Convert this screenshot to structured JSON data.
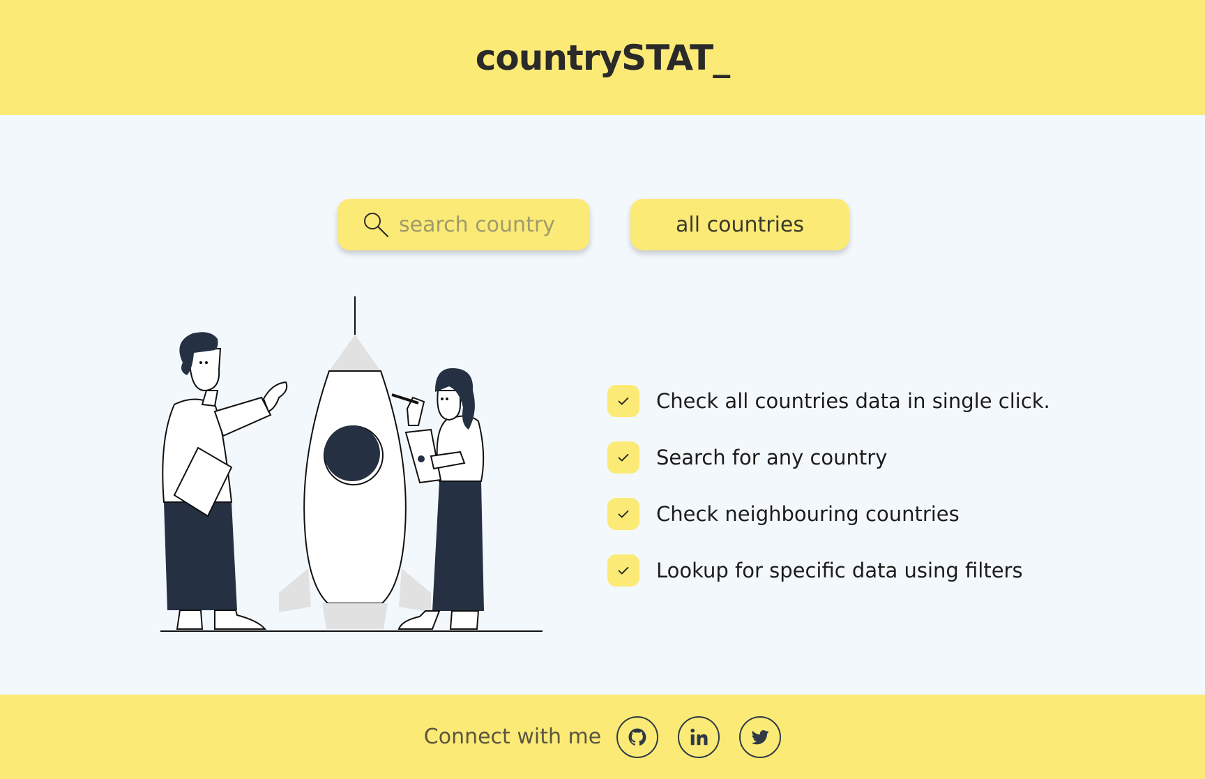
{
  "header": {
    "brand": "countrySTAT_"
  },
  "search": {
    "placeholder": "search country",
    "value": ""
  },
  "buttons": {
    "all_countries": "all countries"
  },
  "features": [
    "Check all countries data in single click.",
    "Search for any country",
    "Check neighbouring countries",
    "Lookup for specific data using filters"
  ],
  "footer": {
    "connect_label": "Connect with me",
    "social": [
      "github-icon",
      "linkedin-icon",
      "twitter-icon"
    ]
  },
  "colors": {
    "accent": "#fcea76",
    "background": "#f3f8fc",
    "ink": "#222b35"
  }
}
